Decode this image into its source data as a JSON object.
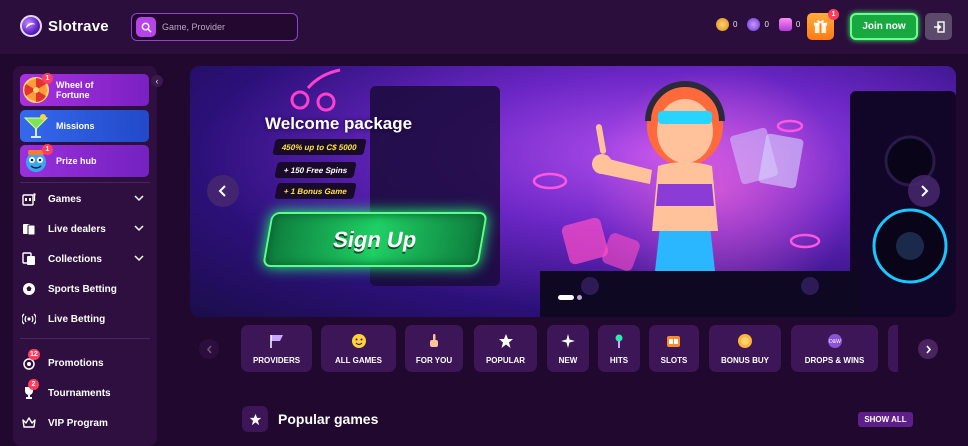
{
  "header": {
    "logo_text": "Slotrave",
    "search_placeholder": "Game, Provider",
    "balances": [
      {
        "icon": "gold-coin-icon",
        "value": "0",
        "color": "#e8a23a"
      },
      {
        "icon": "purple-coin-icon",
        "value": "0",
        "color": "#9c5cf5"
      },
      {
        "icon": "ticket-icon",
        "value": "0",
        "color": "#d25ef0"
      }
    ],
    "gift_badge": "1",
    "join_label": "Join now"
  },
  "sidebar": {
    "promos": [
      {
        "label": "Wheel of Fortune",
        "badge": "1",
        "color": "#9a2fd6"
      },
      {
        "label": "Missions",
        "badge": "",
        "color": "#2d5fe0"
      },
      {
        "label": "Prize hub",
        "badge": "1",
        "color": "#8b2ed4"
      }
    ],
    "items": [
      {
        "label": "Games",
        "icon": "slot-machine-icon",
        "has_chevron": true,
        "badge": ""
      },
      {
        "label": "Live dealers",
        "icon": "cards-icon",
        "has_chevron": true,
        "badge": ""
      },
      {
        "label": "Collections",
        "icon": "collection-icon",
        "has_chevron": true,
        "badge": ""
      },
      {
        "label": "Sports Betting",
        "icon": "soccer-ball-icon",
        "has_chevron": false,
        "badge": ""
      },
      {
        "label": "Live Betting",
        "icon": "broadcast-icon",
        "has_chevron": false,
        "badge": ""
      },
      {
        "label": "Promotions",
        "icon": "promotion-icon",
        "has_chevron": false,
        "badge": "12"
      },
      {
        "label": "Tournaments",
        "icon": "trophy-icon",
        "has_chevron": false,
        "badge": "2"
      },
      {
        "label": "VIP Program",
        "icon": "crown-icon",
        "has_chevron": false,
        "badge": ""
      }
    ]
  },
  "banner": {
    "title": "Welcome package",
    "offer_1": "450% up to C$ 5000",
    "offer_2": "+ 150 Free Spins",
    "offer_3": "+ 1 Bonus Game",
    "cta": "Sign Up",
    "slide_index": 1,
    "slide_count": 2
  },
  "categories": [
    {
      "label": "PROVIDERS",
      "icon": "flag-icon"
    },
    {
      "label": "ALL GAMES",
      "icon": "smiley-icon"
    },
    {
      "label": "FOR YOU",
      "icon": "pointing-hand-icon"
    },
    {
      "label": "POPULAR",
      "icon": "star-icon"
    },
    {
      "label": "NEW",
      "icon": "sparkle-icon"
    },
    {
      "label": "HITS",
      "icon": "microphone-icon"
    },
    {
      "label": "SLOTS",
      "icon": "slot-machine-icon"
    },
    {
      "label": "BONUS BUY",
      "icon": "coin-bag-icon"
    },
    {
      "label": "DROPS & WINS",
      "icon": "drops-wins-icon"
    }
  ],
  "popular": {
    "title": "Popular games",
    "show_all": "SHOW ALL"
  }
}
